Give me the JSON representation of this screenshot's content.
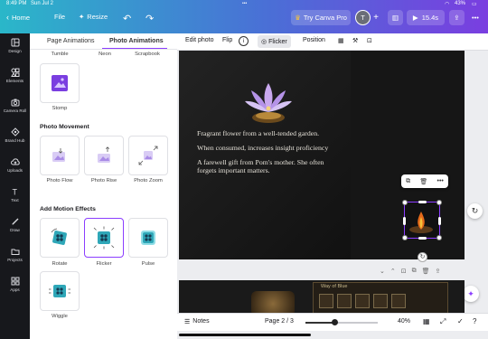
{
  "status_bar": {
    "time": "8:49 PM",
    "date": "Sun Jul 2",
    "battery": "43%"
  },
  "header": {
    "home": "Home",
    "file": "File",
    "resize": "Resize",
    "try_pro": "Try Canva Pro",
    "avatar_initial": "T",
    "play_time": "15.4s"
  },
  "sidebar": {
    "items": [
      {
        "label": "Design",
        "icon": "layout-icon"
      },
      {
        "label": "Elements",
        "icon": "shapes-icon"
      },
      {
        "label": "Camera Roll",
        "icon": "camera-icon"
      },
      {
        "label": "Brand Hub",
        "icon": "brand-icon"
      },
      {
        "label": "Uploads",
        "icon": "cloud-upload-icon"
      },
      {
        "label": "Text",
        "icon": "text-icon"
      },
      {
        "label": "Draw",
        "icon": "draw-icon"
      },
      {
        "label": "Projects",
        "icon": "folder-icon"
      },
      {
        "label": "Apps",
        "icon": "apps-icon"
      }
    ]
  },
  "panel": {
    "tabs": [
      "Page Animations",
      "Photo Animations"
    ],
    "active_tab": "Photo Animations",
    "top_labels": [
      "Tumble",
      "Neon",
      "Scrapbook"
    ],
    "stomp_label": "Stomp",
    "photo_movement": {
      "heading": "Photo Movement",
      "items": [
        "Photo Flow",
        "Photo Rise",
        "Photo Zoom"
      ]
    },
    "motion_effects": {
      "heading": "Add Motion Effects",
      "items": [
        "Rotate",
        "Flicker",
        "Pulse"
      ],
      "extra": "Wiggle",
      "selected": "Flicker"
    }
  },
  "toolbar": {
    "edit_photo": "Edit photo",
    "flip": "Flip",
    "flicker": "Flicker",
    "position": "Position"
  },
  "canvas": {
    "line1": "Fragrant flower from a well-tended garden.",
    "line2": "When consumed, increases insight proficiency",
    "line3a": "A farewell gift from Pom's mother. She often",
    "line3b": "forgets important matters."
  },
  "page2": {
    "label": "Way of Blue"
  },
  "bottom_bar": {
    "notes": "Notes",
    "page": "Page 2 / 3",
    "zoom": "40%",
    "zoom_level": 0.4
  },
  "colors": {
    "accent": "#8b3dff",
    "topbar_start": "#2ab7c9",
    "topbar_end": "#7a3ee0"
  }
}
